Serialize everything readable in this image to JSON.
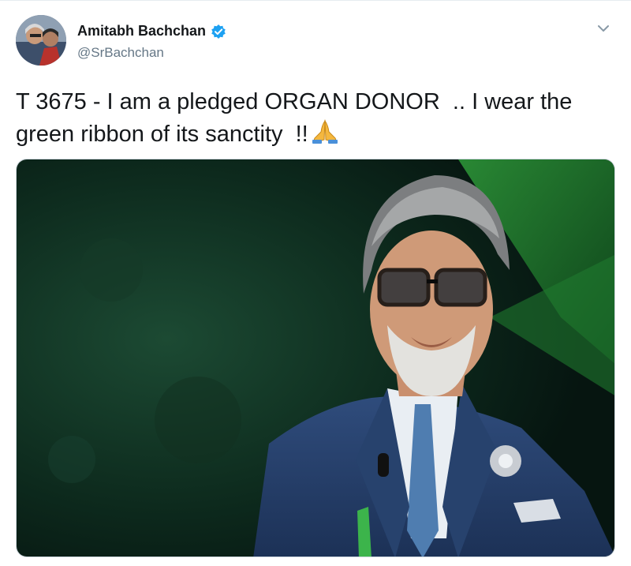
{
  "tweet": {
    "author_name": "Amitabh Bachchan",
    "handle": "@SrBachchan",
    "text_line1": "T 3675 - I am a pledged ORGAN DONOR  .. I wear the",
    "text_line2": "green ribbon of its sanctity  !!",
    "emoji": "folded-hands-emoji",
    "verified": true
  },
  "icons": {
    "verified": "verified-badge-icon",
    "menu": "chevron-down-icon"
  },
  "colors": {
    "verified_blue": "#1da1f2",
    "handle_gray": "#657786",
    "ribbon_green": "#3cb44b"
  }
}
